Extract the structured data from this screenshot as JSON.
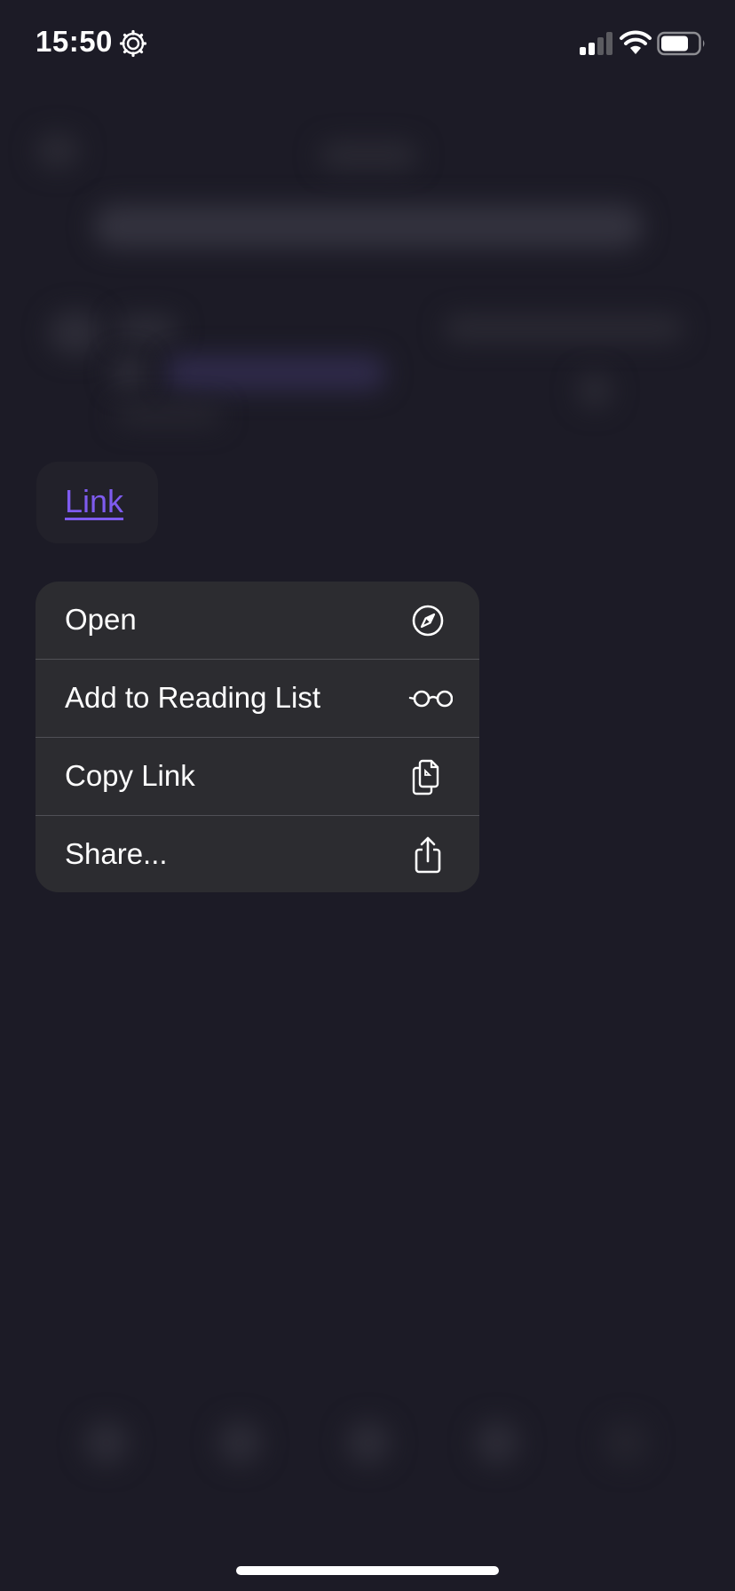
{
  "status_bar": {
    "time": "15:50",
    "icons": [
      "settings-gear-icon",
      "cellular-signal-icon",
      "wifi-icon",
      "battery-icon"
    ]
  },
  "link_preview": {
    "text": "Link",
    "color": "#7e5bef"
  },
  "context_menu": {
    "items": [
      {
        "label": "Open",
        "icon": "compass-icon"
      },
      {
        "label": "Add to Reading List",
        "icon": "glasses-icon"
      },
      {
        "label": "Copy Link",
        "icon": "copy-documents-icon"
      },
      {
        "label": "Share...",
        "icon": "share-icon"
      }
    ]
  },
  "colors": {
    "background": "#1c1b26",
    "menu_background": "#2c2c30",
    "accent": "#7e5bef"
  }
}
